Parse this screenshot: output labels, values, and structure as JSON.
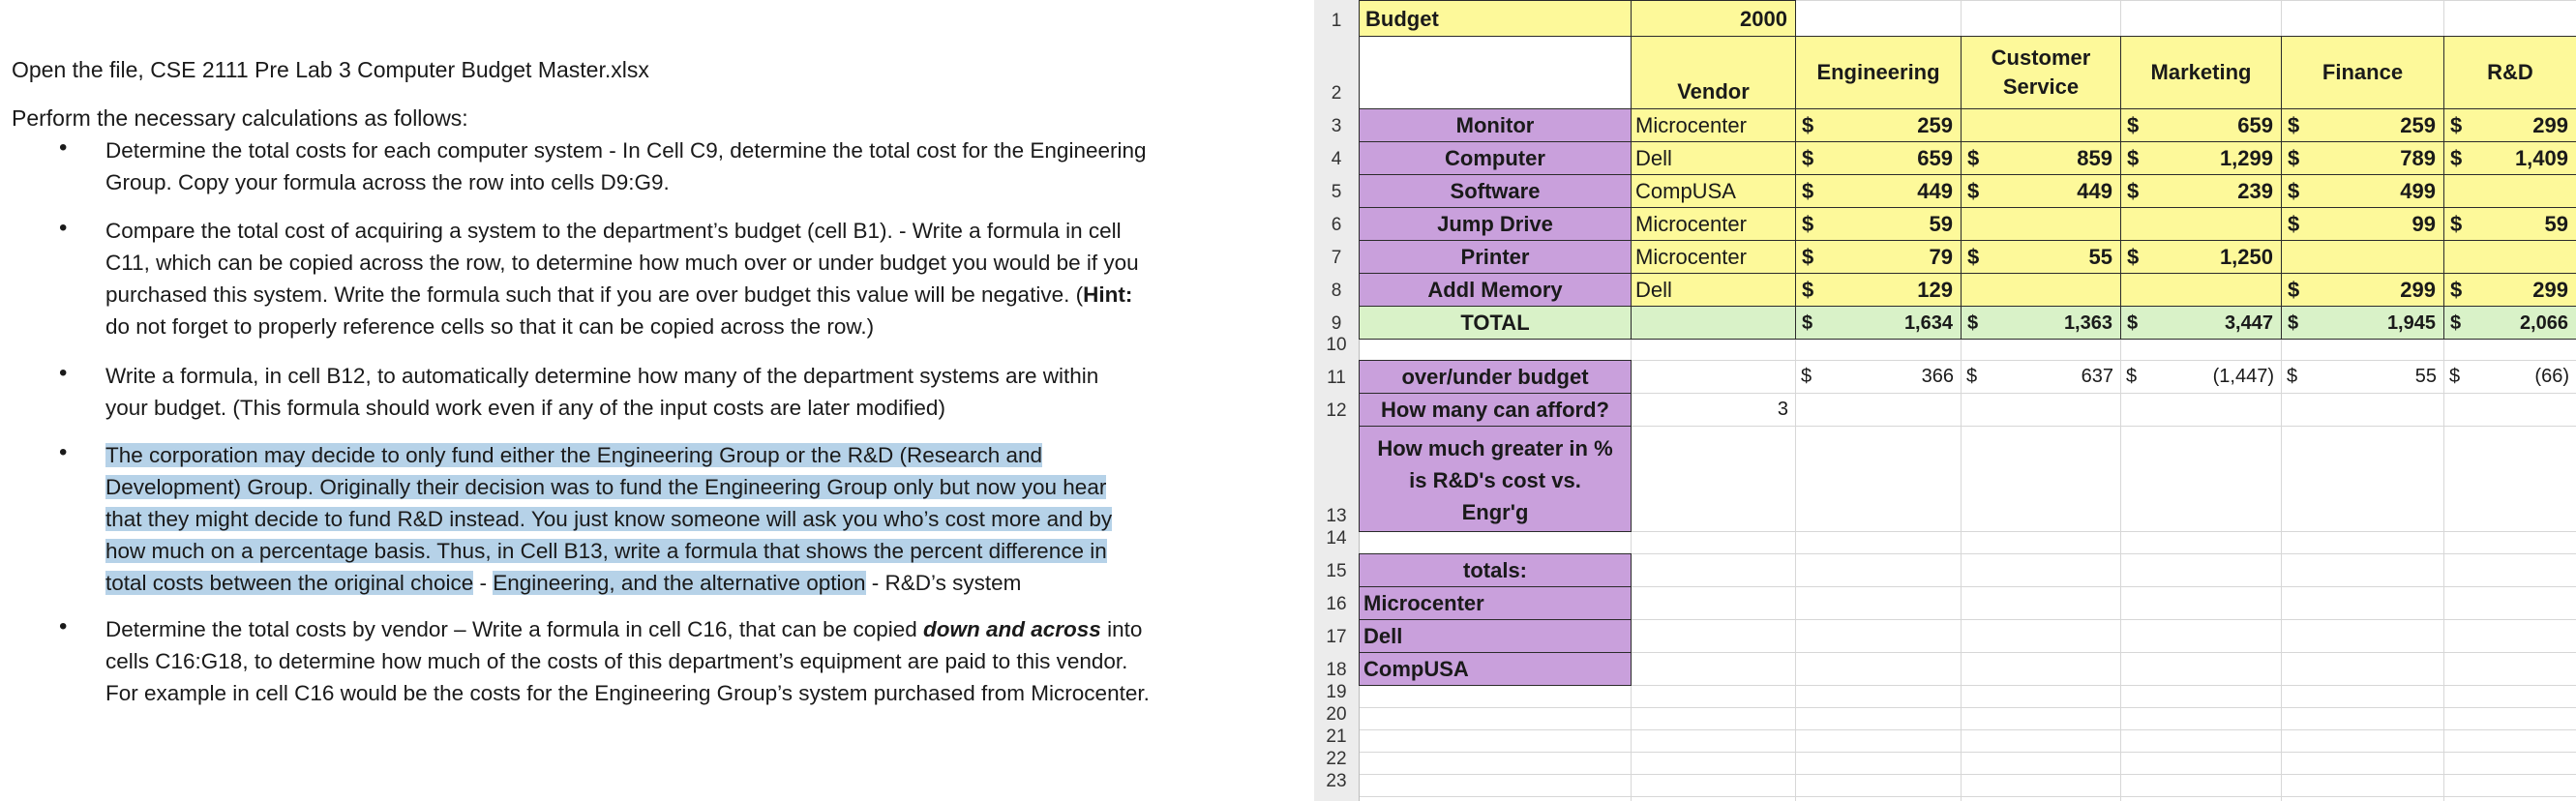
{
  "instructions": {
    "open_file": "Open the file, CSE 2111 Pre Lab 3 Computer Budget Master.xlsx",
    "intro": "Perform the necessary calculations as follows:",
    "b1_l1": "Determine the total costs for each computer system - In Cell C9, determine the total cost for the Engineering",
    "b1_l2": "Group.  Copy your formula across the row into cells D9:G9.",
    "b2_l1": "Compare the total cost of acquiring a system to the department’s budget (cell B1). -  Write a formula in cell",
    "b2_l2": "C11, which can be copied across the row, to determine how much over or under budget you would be if you",
    "b2_l3": "purchased this system.  Write the formula such that if you are over budget this value will be negative.  (",
    "b2_hint": "Hint:",
    "b2_l4": "do not forget to properly reference cells so that it can be copied across the row.)",
    "b3_l1": "Write a formula, in cell B12, to automatically determine how many of the department systems are within",
    "b3_l2": "your budget. (This formula should work even if any of the input costs are later modified)",
    "b4_l1": "The corporation may decide to only fund either the Engineering Group or the R&D (Research and",
    "b4_l2": "Development) Group.  Originally their decision was to fund the Engineering Group only but now you hear",
    "b4_l3": "that they might decide to fund R&D instead.  You just know someone will ask you who’s cost more and by",
    "b4_l4": "how much on a percentage basis.  Thus, in Cell B13, write a formula that shows the percent difference in",
    "b4_l5a": "total costs between the original choice",
    "b4_l5b": " - ",
    "b4_l5c": "Engineering, and the alternative option",
    "b4_l5d": " - R&D’s system",
    "b5_l1a": "Determine the total costs by vendor – Write a formula in cell C16, that can be copied ",
    "b5_l1b": "down and across",
    "b5_l1c": " into",
    "b5_l2": "cells C16:G18, to determine how much of the costs of this department’s equipment are paid to this vendor.",
    "b5_l3": "For example in cell C16 would be the costs for the Engineering Group’s system purchased from Microcenter."
  },
  "sheet": {
    "row_numbers": [
      "1",
      "2",
      "3",
      "4",
      "5",
      "6",
      "7",
      "8",
      "9",
      "10",
      "11",
      "12",
      "13",
      "14",
      "15",
      "16",
      "17",
      "18",
      "19",
      "20",
      "21",
      "22",
      "23"
    ],
    "budget_label": "Budget",
    "budget_value": "2000",
    "vendor_header": "Vendor",
    "departments": [
      "Engineering",
      "Customer Service",
      "Marketing",
      "Finance",
      "R&D"
    ],
    "items": [
      {
        "name": "Monitor",
        "vendor": "Microcenter",
        "values": [
          "259",
          "",
          "659",
          "259",
          "299"
        ]
      },
      {
        "name": "Computer",
        "vendor": "Dell",
        "values": [
          "659",
          "859",
          "1,299",
          "789",
          "1,409"
        ]
      },
      {
        "name": "Software",
        "vendor": "CompUSA",
        "values": [
          "449",
          "449",
          "239",
          "499",
          ""
        ]
      },
      {
        "name": "Jump Drive",
        "vendor": "Microcenter",
        "values": [
          "59",
          "",
          "",
          "99",
          "59"
        ]
      },
      {
        "name": "Printer",
        "vendor": "Microcenter",
        "values": [
          "79",
          "55",
          "1,250",
          "",
          ""
        ]
      },
      {
        "name": "Addl Memory",
        "vendor": "Dell",
        "values": [
          "129",
          "",
          "",
          "299",
          "299"
        ]
      }
    ],
    "total_label": "TOTAL",
    "totals": [
      "1,634",
      "1,363",
      "3,447",
      "1,945",
      "2,066"
    ],
    "over_under_label": "over/under budget",
    "over_under": [
      "366",
      "637",
      "(1,447)",
      "55",
      "(66)"
    ],
    "afford_label": "How many can afford?",
    "afford_value": "3",
    "pct_label_l1": "How much greater in %",
    "pct_label_l2": "is R&D's cost vs.",
    "pct_label_l3": "Engr'g",
    "totals_label": "totals:",
    "vendors": [
      "Microcenter",
      "Dell",
      "CompUSA"
    ],
    "currency": "$"
  }
}
